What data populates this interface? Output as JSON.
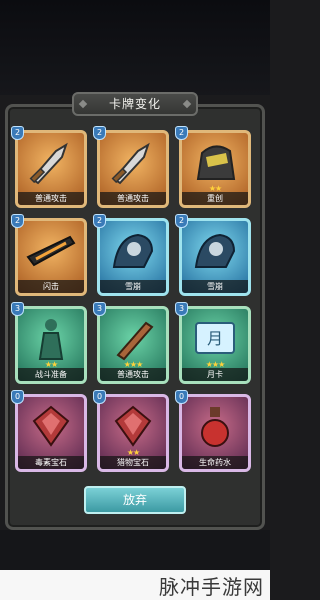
{
  "panel": {
    "title": "卡牌变化"
  },
  "cards": [
    {
      "label": "普通攻击",
      "badge": "2",
      "stars": "",
      "theme": "brown",
      "icon": "sword-icon"
    },
    {
      "label": "普通攻击",
      "badge": "2",
      "stars": "",
      "theme": "brown",
      "icon": "sword-icon"
    },
    {
      "label": "重创",
      "badge": "2",
      "stars": "★★",
      "theme": "brown",
      "icon": "helmet-icon"
    },
    {
      "label": "闪击",
      "badge": "2",
      "stars": "",
      "theme": "brown",
      "icon": "blade-icon"
    },
    {
      "label": "雪崩",
      "badge": "2",
      "stars": "",
      "theme": "blue",
      "icon": "knight-icon"
    },
    {
      "label": "雪崩",
      "badge": "2",
      "stars": "",
      "theme": "blue",
      "icon": "knight-icon"
    },
    {
      "label": "战斗准备",
      "badge": "3",
      "stars": "★★",
      "theme": "green",
      "icon": "statue-icon"
    },
    {
      "label": "普通攻击",
      "badge": "3",
      "stars": "★★★",
      "theme": "green",
      "icon": "club-icon"
    },
    {
      "label": "月卡",
      "badge": "3",
      "stars": "★★★",
      "theme": "green",
      "icon": "month-card-icon"
    },
    {
      "label": "毒素宝石",
      "badge": "0",
      "stars": "",
      "theme": "purple",
      "icon": "gem-icon"
    },
    {
      "label": "猎物宝石",
      "badge": "0",
      "stars": "★★",
      "theme": "purple",
      "icon": "gem-icon"
    },
    {
      "label": "生命药水",
      "badge": "0",
      "stars": "",
      "theme": "purple",
      "icon": "potion-icon"
    }
  ],
  "confirm": {
    "label": "放弃"
  },
  "watermark": {
    "text": "脉冲手游网"
  }
}
